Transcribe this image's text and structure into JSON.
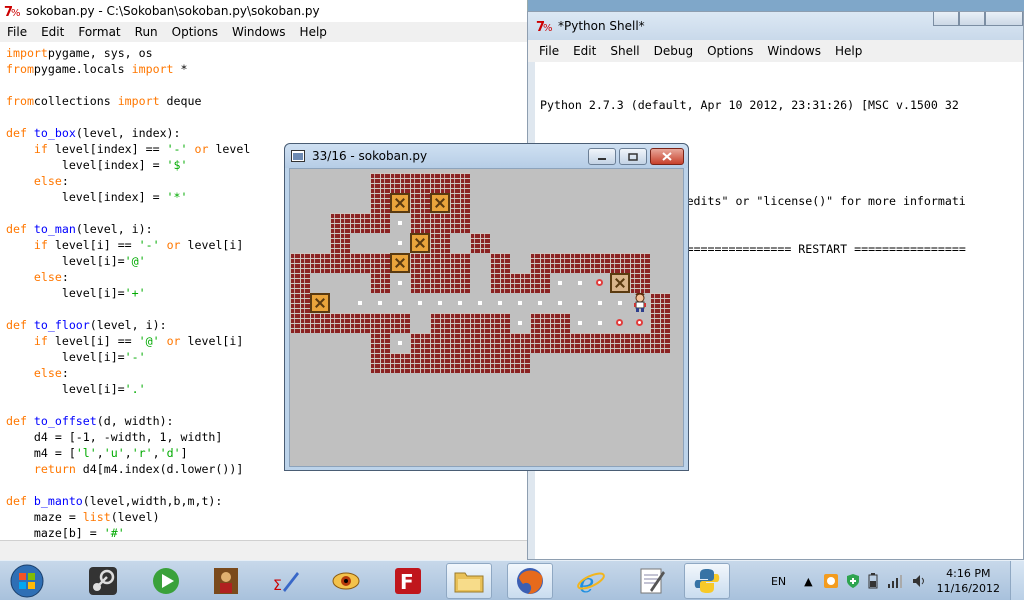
{
  "editor": {
    "title": "sokoban.py - C:\\Sokoban\\sokoban.py\\sokoban.py",
    "menu": [
      "File",
      "Edit",
      "Format",
      "Run",
      "Options",
      "Windows",
      "Help"
    ],
    "code": [
      [
        [
          "kw",
          "import"
        ],
        [
          "",
          "pygame, sys, os"
        ]
      ],
      [
        [
          "kw",
          "from"
        ],
        [
          "",
          "pygame.locals "
        ],
        [
          "kw",
          "import"
        ],
        [
          "",
          " *"
        ]
      ],
      [],
      [
        [
          "kw",
          "from"
        ],
        [
          "",
          "collections "
        ],
        [
          "kw",
          "import"
        ],
        [
          "",
          " deque"
        ]
      ],
      [],
      [
        [
          "kw",
          "def "
        ],
        [
          "fn",
          "to_box"
        ],
        [
          "",
          "(level, index):"
        ]
      ],
      [
        [
          "",
          "    "
        ],
        [
          "kw",
          "if"
        ],
        [
          "",
          " level[index] == "
        ],
        [
          "str",
          "'-'"
        ],
        [
          "",
          " "
        ],
        [
          "kw",
          "or"
        ],
        [
          "",
          " level"
        ]
      ],
      [
        [
          "",
          "        level[index] = "
        ],
        [
          "str",
          "'$'"
        ]
      ],
      [
        [
          "",
          "    "
        ],
        [
          "kw",
          "else"
        ],
        [
          "",
          ":"
        ]
      ],
      [
        [
          "",
          "        level[index] = "
        ],
        [
          "str",
          "'*'"
        ]
      ],
      [],
      [
        [
          "kw",
          "def "
        ],
        [
          "fn",
          "to_man"
        ],
        [
          "",
          "(level, i):"
        ]
      ],
      [
        [
          "",
          "    "
        ],
        [
          "kw",
          "if"
        ],
        [
          "",
          " level[i] == "
        ],
        [
          "str",
          "'-'"
        ],
        [
          "",
          " "
        ],
        [
          "kw",
          "or"
        ],
        [
          "",
          " level[i]"
        ]
      ],
      [
        [
          "",
          "        level[i]="
        ],
        [
          "str",
          "'@'"
        ]
      ],
      [
        [
          "",
          "    "
        ],
        [
          "kw",
          "else"
        ],
        [
          "",
          ":"
        ]
      ],
      [
        [
          "",
          "        level[i]="
        ],
        [
          "str",
          "'+'"
        ]
      ],
      [],
      [
        [
          "kw",
          "def "
        ],
        [
          "fn",
          "to_floor"
        ],
        [
          "",
          "(level, i):"
        ]
      ],
      [
        [
          "",
          "    "
        ],
        [
          "kw",
          "if"
        ],
        [
          "",
          " level[i] == "
        ],
        [
          "str",
          "'@'"
        ],
        [
          "",
          " "
        ],
        [
          "kw",
          "or"
        ],
        [
          "",
          " level[i]"
        ]
      ],
      [
        [
          "",
          "        level[i]="
        ],
        [
          "str",
          "'-'"
        ]
      ],
      [
        [
          "",
          "    "
        ],
        [
          "kw",
          "else"
        ],
        [
          "",
          ":"
        ]
      ],
      [
        [
          "",
          "        level[i]="
        ],
        [
          "str",
          "'.'"
        ]
      ],
      [],
      [
        [
          "kw",
          "def "
        ],
        [
          "fn",
          "to_offset"
        ],
        [
          "",
          "(d, width):"
        ]
      ],
      [
        [
          "",
          "    d4 = [-1, -width, 1, width]"
        ]
      ],
      [
        [
          "",
          "    m4 = ["
        ],
        [
          "str",
          "'l'"
        ],
        [
          "",
          ","
        ],
        [
          "str",
          "'u'"
        ],
        [
          "",
          ","
        ],
        [
          "str",
          "'r'"
        ],
        [
          "",
          ","
        ],
        [
          "str",
          "'d'"
        ],
        [
          "",
          "]"
        ]
      ],
      [
        [
          "",
          "    "
        ],
        [
          "kw",
          "return"
        ],
        [
          "",
          " d4[m4.index(d.lower())]"
        ]
      ],
      [],
      [
        [
          "kw",
          "def "
        ],
        [
          "fn",
          "b_manto"
        ],
        [
          "",
          "(level,width,b,m,t):"
        ]
      ],
      [
        [
          "",
          "    maze = "
        ],
        [
          "kw",
          "list"
        ],
        [
          "",
          "(level)"
        ]
      ],
      [
        [
          "",
          "    maze[b] = "
        ],
        [
          "str",
          "'#'"
        ]
      ]
    ]
  },
  "shell": {
    "title": "*Python Shell*",
    "menu": [
      "File",
      "Edit",
      "Shell",
      "Debug",
      "Options",
      "Windows",
      "Help"
    ],
    "lines": [
      "Python 2.7.3 (default, Apr 10 2012, 23:31:26) [MSC v.1500 32",
      "32",
      "Type \"copyright\", \"credits\" or \"license()\" for more informati"
    ],
    "prompt": ">>>",
    "restart_line": " ================================ RESTART ================",
    "prompt2": ">>>"
  },
  "game": {
    "title": "33/16 - sokoban.py",
    "map": [
      "....wwwww.........",
      "....wBwBw.........",
      "..www-www.........",
      "..w..-Bw.w........",
      "wwwwwBwww.w.wwwwww",
      "w...w-www.wwwxxgGw",
      "wB.--------------@w",
      "wwwwww.wwwwxwwxxggw",
      "....w-wwwwwwwwwwwww",
      "....wwwwwwww......."
    ]
  },
  "taskbar": {
    "items": [
      "start-orb",
      "steam-icon",
      "game-icon",
      "warrior-icon",
      "editor-icon",
      "eye-icon",
      "filezilla-icon",
      "folder-icon",
      "firefox-icon",
      "ie-icon",
      "notepad-icon",
      "python-icon"
    ],
    "lang": "EN",
    "time": "4:16 PM",
    "date": "11/16/2012"
  }
}
